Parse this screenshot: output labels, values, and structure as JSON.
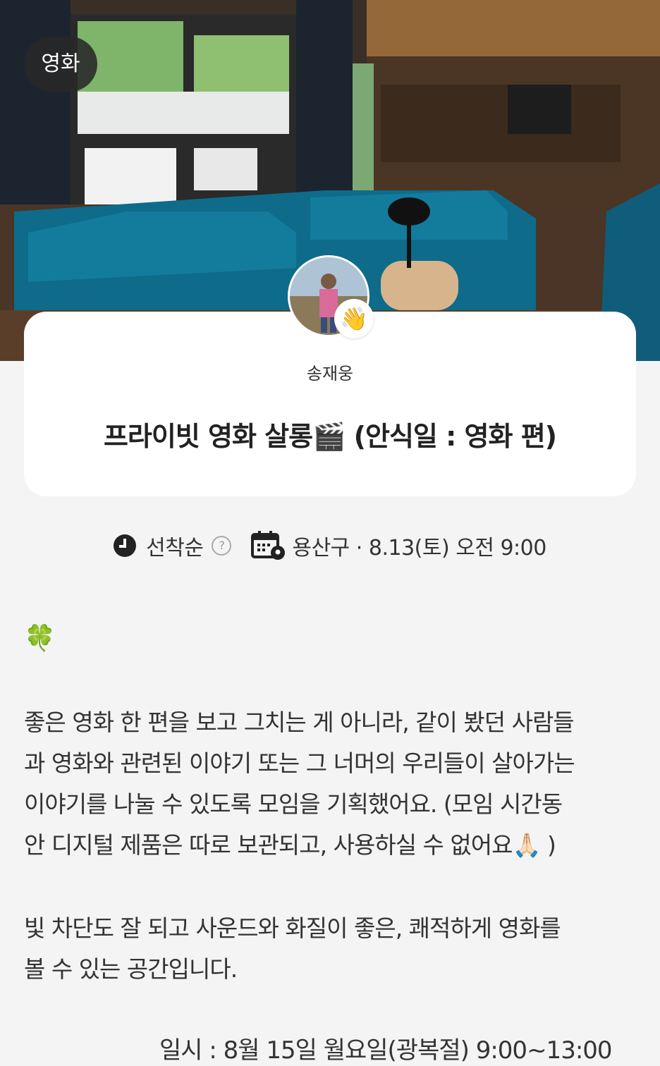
{
  "category_chip": "영화",
  "host": {
    "name": "송재웅",
    "badge_icon": "waving-hand-icon"
  },
  "meetup": {
    "title": "프라이빗 영화 살롱🎬 (안식일 : 영화 편)"
  },
  "meta": {
    "join_type": "선착순",
    "help_symbol": "?",
    "location_datetime": "용산구 · 8.13(토) 오전 9:00"
  },
  "description": {
    "emoji": "🍀",
    "paragraph_1": "좋은 영화 한 편을 보고 그치는 게 아니라, 같이 봤던 사람들\n과 영화와 관련된 이야기 또는 그 너머의 우리들이 살아가는\n이야기를 나눌 수 있도록 모임을 기획했어요.  (모임 시간동\n안 디지털 제품은 따로 보관되고, 사용하실 수 없어요🙏🏻 )",
    "paragraph_2": "빛 차단도 잘 되고 사운드와 화질이 좋은,  쾌적하게 영화를\n볼 수 있는 공간입니다.",
    "schedule": "일시 : 8월 15일 월요일(광복절) 9:00~13:00"
  },
  "colors": {
    "background": "#f4f4f4",
    "card": "#ffffff",
    "sofa": "#0e6b8a",
    "chip": "#282828"
  }
}
